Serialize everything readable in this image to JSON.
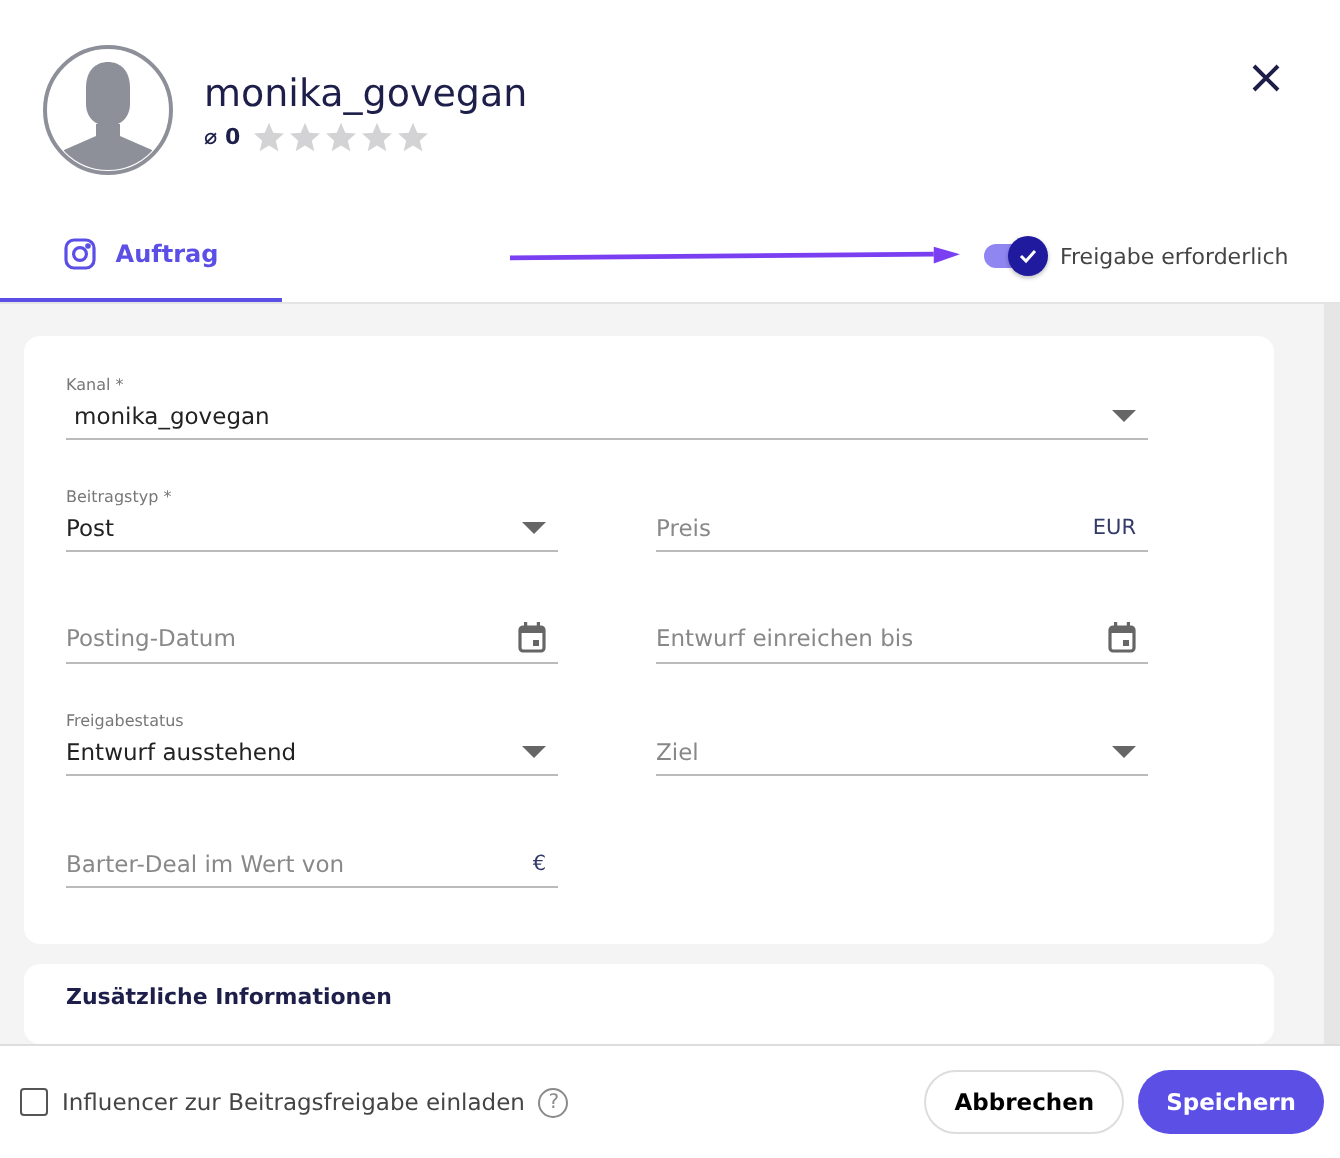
{
  "profile": {
    "name": "monika_govegan",
    "average": "⌀ 0",
    "stars": 0
  },
  "tabs": [
    {
      "label": "Auftrag",
      "selected": true
    }
  ],
  "approval_toggle": {
    "label": "Freigabe erforderlich",
    "on": true
  },
  "form": {
    "rows": [
      [
        {
          "kind": "select",
          "label": "Kanal *",
          "value": "monika_govegan"
        }
      ],
      [
        {
          "kind": "select",
          "label": "Beitragstyp *",
          "value": "Post"
        },
        {
          "kind": "text",
          "placeholder": "Preis",
          "suffix": "EUR"
        }
      ],
      [
        {
          "kind": "date",
          "placeholder": "Posting-Datum"
        },
        {
          "kind": "date",
          "placeholder": "Entwurf einreichen bis"
        }
      ],
      [
        {
          "kind": "select",
          "label": "Freigabestatus",
          "value": "Entwurf ausstehend"
        },
        {
          "kind": "select",
          "placeholder": "Ziel"
        }
      ],
      [
        {
          "kind": "text",
          "placeholder": "Barter-Deal im Wert von",
          "suffix": "€"
        }
      ]
    ]
  },
  "additional_section": {
    "title": "Zusätzliche Informationen"
  },
  "footer": {
    "invite": {
      "label": "Influencer zur Beitragsfreigabe einladen",
      "checked": false,
      "help": "?"
    },
    "buttons": [
      "Abbrechen",
      "Speichern"
    ]
  }
}
